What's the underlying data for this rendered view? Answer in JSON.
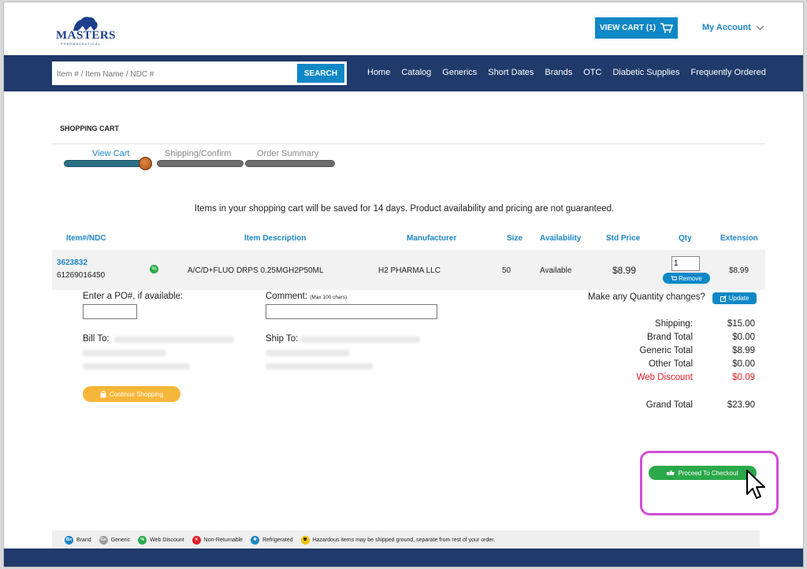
{
  "header": {
    "logo_text": "MASTERS",
    "logo_sub": "PHARMACEUTICAL",
    "view_cart_label": "VIEW CART (1)",
    "my_account_label": "My Account",
    "search_placeholder": "Item # / Item Name / NDC #",
    "search_button": "SEARCH",
    "nav": [
      "Home",
      "Catalog",
      "Generics",
      "Short Dates",
      "Brands",
      "OTC",
      "Diabetic Supplies",
      "Frequently Ordered"
    ]
  },
  "cart": {
    "title": "SHOPPING CART",
    "steps": [
      "View Cart",
      "Shipping/Confirm",
      "Order Summary"
    ],
    "notice": "Items in your shopping cart will be saved for 14 days. Product availability and pricing are not guaranteed.",
    "columns": [
      "Item#/NDC",
      "Item Description",
      "Manufacturer",
      "Size",
      "Availability",
      "Std Price",
      "Qty",
      "Extension"
    ],
    "item": {
      "item_number": "3623832",
      "ndc": "61269016450",
      "badge": "%",
      "description": "A/C/D+FLUO DRPS 0.25MGH2P50ML",
      "manufacturer": "H2 PHARMA LLC",
      "size": "50",
      "availability": "Available",
      "std_price": "$8.99",
      "qty": "1",
      "remove_label": "Remove",
      "extension": "$8.99"
    },
    "po_label": "Enter a PO#, if available:",
    "comment_label": "Comment:",
    "comment_hint": "(Max 100 chars)",
    "qty_changes_label": "Make any Quantity changes?",
    "update_label": "Update",
    "bill_to_label": "Bill To:",
    "ship_to_label": "Ship To:",
    "continue_label": "Continue Shopping",
    "totals": [
      {
        "label": "Shipping:",
        "value": "$15.00"
      },
      {
        "label": "Brand Total",
        "value": "$0.00"
      },
      {
        "label": "Generic Total",
        "value": "$8.99"
      },
      {
        "label": "Other Total",
        "value": "$0.00"
      },
      {
        "label": "Web Discount",
        "value": "$0.09"
      }
    ],
    "grand_total_label": "Grand Total",
    "grand_total_value": "$23.90",
    "checkout_label": "Proceed To Checkout"
  },
  "legend": [
    {
      "badge": "Bx",
      "label": "Brand",
      "color": "#1f86c5"
    },
    {
      "badge": "Gx",
      "label": "Generic",
      "color": "#9a9a9a"
    },
    {
      "badge": "%",
      "label": "Web Discount",
      "color": "#2ba84a"
    },
    {
      "badge": "✕",
      "label": "Non-Returnable",
      "color": "#e01f2a"
    },
    {
      "badge": "❄",
      "label": "Refrigerated",
      "color": "#1f86c5"
    },
    {
      "badge": "☢",
      "label": "Hazardous items may be shipped ground, separate from rest of your order.",
      "color": "#f2c200"
    }
  ]
}
